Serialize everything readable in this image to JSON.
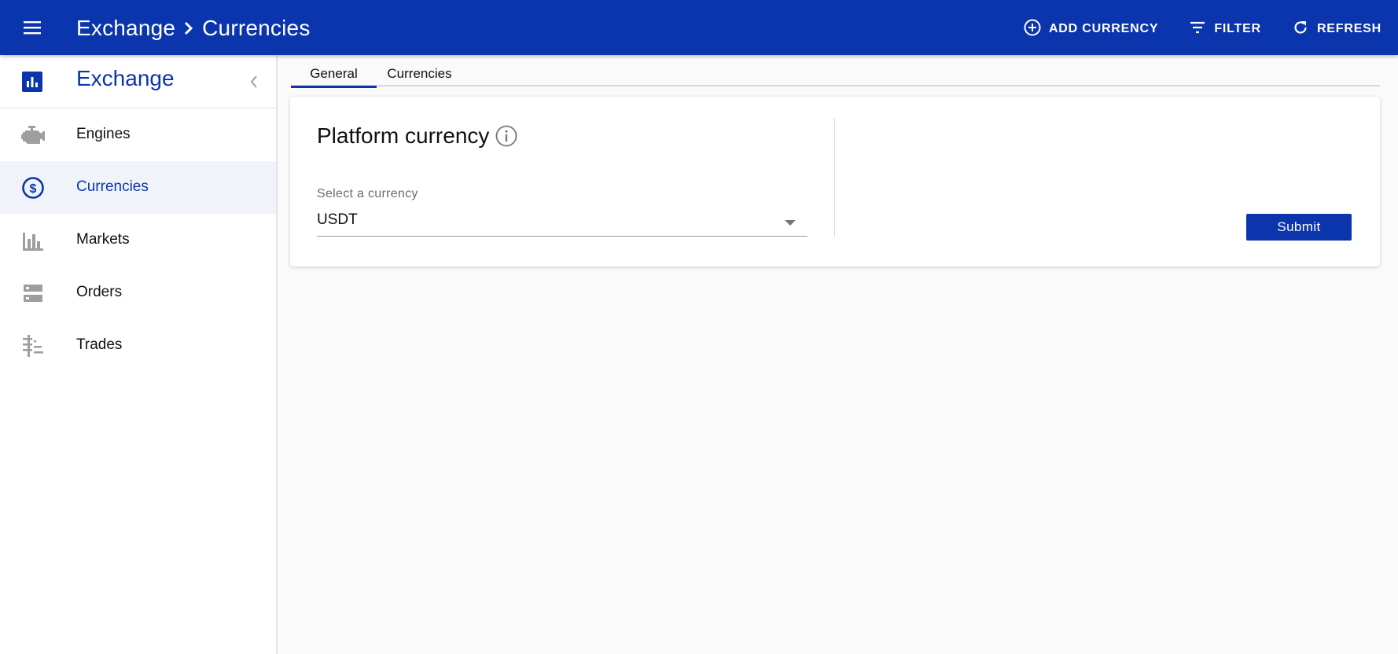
{
  "topbar": {
    "menu_icon": "menu-icon",
    "breadcrumb": [
      "Exchange",
      "Currencies"
    ],
    "separator_icon": "chevron-right-icon",
    "actions": [
      {
        "label": "ADD CURRENCY",
        "icon": "add-circle-icon"
      },
      {
        "label": "FILTER",
        "icon": "filter-icon"
      },
      {
        "label": "REFRESH",
        "icon": "refresh-icon"
      }
    ],
    "color": "#0b35ac"
  },
  "sidebar": {
    "title": "Exchange",
    "title_icon": "bar-chart-icon",
    "collapse_icon": "chevron-left-icon",
    "items": [
      {
        "label": "Engines",
        "icon": "engine-icon",
        "active": false
      },
      {
        "label": "Currencies",
        "icon": "dollar-circle-icon",
        "active": true
      },
      {
        "label": "Markets",
        "icon": "bar-chart-icon",
        "active": false
      },
      {
        "label": "Orders",
        "icon": "storage-icon",
        "active": false
      },
      {
        "label": "Trades",
        "icon": "trades-icon",
        "active": false
      }
    ]
  },
  "tabs": [
    {
      "label": "General",
      "active": true
    },
    {
      "label": "Currencies",
      "active": false
    }
  ],
  "card": {
    "title": "Platform currency",
    "info_icon": "info-icon",
    "select_label": "Select a currency",
    "select_value": "USDT",
    "submit_label": "Submit"
  }
}
